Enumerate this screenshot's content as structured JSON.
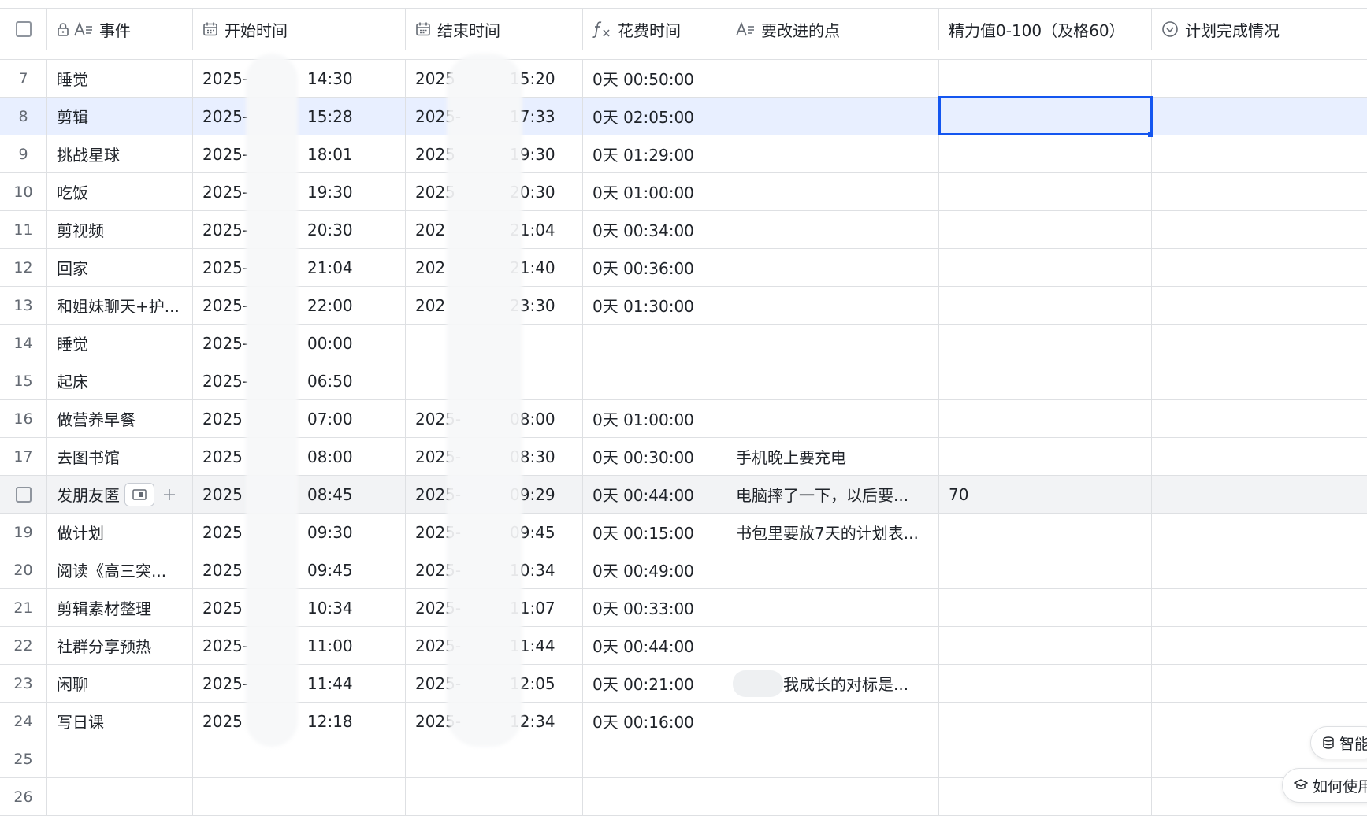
{
  "columns": {
    "event": "事件",
    "start": "开始时间",
    "end": "结束时间",
    "duration": "花费时间",
    "improve": "要改进的点",
    "energy": "精力值0-100（及格60）",
    "plan": "计划完成情况"
  },
  "rows": [
    {
      "num": "7",
      "event": "睡觉",
      "start_prefix": "2025-",
      "start_time": "14:30",
      "end_prefix": "2025",
      "end_time": "15:20",
      "duration": "0天 00:50:00",
      "improve": "",
      "energy": ""
    },
    {
      "num": "8",
      "event": "剪辑",
      "start_prefix": "2025-",
      "start_time": "15:28",
      "end_prefix": "2025-",
      "end_time": "17:33",
      "duration": "0天 02:05:00",
      "improve": "",
      "energy": ""
    },
    {
      "num": "9",
      "event": "挑战星球",
      "start_prefix": "2025-",
      "start_time": "18:01",
      "end_prefix": "2025",
      "end_time": "19:30",
      "duration": "0天 01:29:00",
      "improve": "",
      "energy": ""
    },
    {
      "num": "10",
      "event": "吃饭",
      "start_prefix": "2025-",
      "start_time": "19:30",
      "end_prefix": "2025",
      "end_time": "20:30",
      "duration": "0天 01:00:00",
      "improve": "",
      "energy": ""
    },
    {
      "num": "11",
      "event": "剪视频",
      "start_prefix": "2025-",
      "start_time": "20:30",
      "end_prefix": "202",
      "end_time": "21:04",
      "duration": "0天 00:34:00",
      "improve": "",
      "energy": ""
    },
    {
      "num": "12",
      "event": "回家",
      "start_prefix": "2025-",
      "start_time": "21:04",
      "end_prefix": "202",
      "end_time": "21:40",
      "duration": "0天 00:36:00",
      "improve": "",
      "energy": ""
    },
    {
      "num": "13",
      "event": "和姐妹聊天+护...",
      "start_prefix": "2025-",
      "start_time": "22:00",
      "end_prefix": "202",
      "end_time": "23:30",
      "duration": "0天 01:30:00",
      "improve": "",
      "energy": ""
    },
    {
      "num": "14",
      "event": "睡觉",
      "start_prefix": "2025-",
      "start_time": "00:00",
      "end_prefix": "",
      "end_time": "",
      "duration": "",
      "improve": "",
      "energy": ""
    },
    {
      "num": "15",
      "event": "起床",
      "start_prefix": "2025-",
      "start_time": "06:50",
      "end_prefix": "",
      "end_time": "",
      "duration": "",
      "improve": "",
      "energy": ""
    },
    {
      "num": "16",
      "event": "做营养早餐",
      "start_prefix": "2025",
      "start_time": "07:00",
      "end_prefix": "2025-",
      "end_time": "08:00",
      "duration": "0天 01:00:00",
      "improve": "",
      "energy": ""
    },
    {
      "num": "17",
      "event": "去图书馆",
      "start_prefix": "2025",
      "start_time": "08:00",
      "end_prefix": "2025-",
      "end_time": "08:30",
      "duration": "0天 00:30:00",
      "improve": "手机晚上要充电",
      "energy": ""
    },
    {
      "num": "",
      "event": "发朋友匿",
      "start_prefix": "2025",
      "start_time": "08:45",
      "end_prefix": "2025-",
      "end_time": "09:29",
      "duration": "0天 00:44:00",
      "improve": "电脑摔了一下，以后要...",
      "energy": "70"
    },
    {
      "num": "19",
      "event": "做计划",
      "start_prefix": "2025",
      "start_time": "09:30",
      "end_prefix": "2025-",
      "end_time": "09:45",
      "duration": "0天 00:15:00",
      "improve": "书包里要放7天的计划表...",
      "energy": ""
    },
    {
      "num": "20",
      "event": "阅读《高三突...",
      "start_prefix": "2025",
      "start_time": "09:45",
      "end_prefix": "2025-",
      "end_time": "10:34",
      "duration": "0天 00:49:00",
      "improve": "",
      "energy": ""
    },
    {
      "num": "21",
      "event": "剪辑素材整理",
      "start_prefix": "2025",
      "start_time": "10:34",
      "end_prefix": "2025-",
      "end_time": "11:07",
      "duration": "0天 00:33:00",
      "improve": "",
      "energy": ""
    },
    {
      "num": "22",
      "event": "社群分享预热",
      "start_prefix": "2025-",
      "start_time": "11:00",
      "end_prefix": "2025-",
      "end_time": "11:44",
      "duration": "0天 00:44:00",
      "improve": "",
      "energy": ""
    },
    {
      "num": "23",
      "event": "闲聊",
      "start_prefix": "2025-",
      "start_time": "11:44",
      "end_prefix": "2025-",
      "end_time": "12:05",
      "duration": "0天 00:21:00",
      "improve": "我成长的对标是...",
      "energy": ""
    },
    {
      "num": "24",
      "event": "写日课",
      "start_prefix": "2025",
      "start_time": "12:18",
      "end_prefix": "2025-",
      "end_time": "12:34",
      "duration": "0天 00:16:00",
      "improve": "",
      "energy": ""
    },
    {
      "num": "25",
      "event": "",
      "start_prefix": "",
      "start_time": "",
      "end_prefix": "",
      "end_time": "",
      "duration": "",
      "improve": "",
      "energy": ""
    },
    {
      "num": "26",
      "event": "",
      "start_prefix": "",
      "start_time": "",
      "end_prefix": "",
      "end_time": "",
      "duration": "",
      "improve": "",
      "energy": ""
    }
  ],
  "floating": {
    "smart_label": "智能",
    "help_label": "如何使用"
  },
  "colors": {
    "accent": "#1456f0",
    "selected_row": "#e8efff",
    "hover_row": "#f2f3f5",
    "grid_line": "#dee0e3"
  }
}
